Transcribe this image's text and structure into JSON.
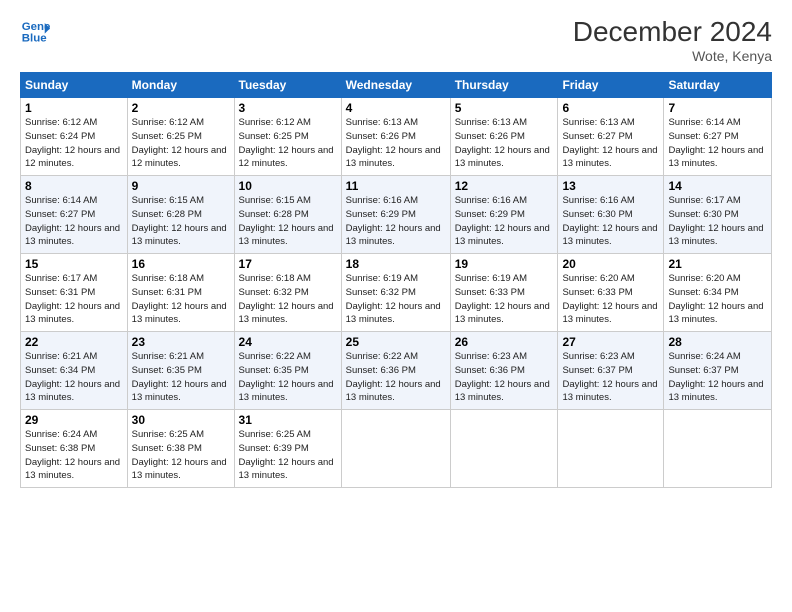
{
  "header": {
    "logo_line1": "General",
    "logo_line2": "Blue",
    "month_title": "December 2024",
    "location": "Wote, Kenya"
  },
  "weekdays": [
    "Sunday",
    "Monday",
    "Tuesday",
    "Wednesday",
    "Thursday",
    "Friday",
    "Saturday"
  ],
  "weeks": [
    [
      {
        "day": "1",
        "sunrise": "6:12 AM",
        "sunset": "6:24 PM",
        "daylight": "12 hours and 12 minutes."
      },
      {
        "day": "2",
        "sunrise": "6:12 AM",
        "sunset": "6:25 PM",
        "daylight": "12 hours and 12 minutes."
      },
      {
        "day": "3",
        "sunrise": "6:12 AM",
        "sunset": "6:25 PM",
        "daylight": "12 hours and 12 minutes."
      },
      {
        "day": "4",
        "sunrise": "6:13 AM",
        "sunset": "6:26 PM",
        "daylight": "12 hours and 13 minutes."
      },
      {
        "day": "5",
        "sunrise": "6:13 AM",
        "sunset": "6:26 PM",
        "daylight": "12 hours and 13 minutes."
      },
      {
        "day": "6",
        "sunrise": "6:13 AM",
        "sunset": "6:27 PM",
        "daylight": "12 hours and 13 minutes."
      },
      {
        "day": "7",
        "sunrise": "6:14 AM",
        "sunset": "6:27 PM",
        "daylight": "12 hours and 13 minutes."
      }
    ],
    [
      {
        "day": "8",
        "sunrise": "6:14 AM",
        "sunset": "6:27 PM",
        "daylight": "12 hours and 13 minutes."
      },
      {
        "day": "9",
        "sunrise": "6:15 AM",
        "sunset": "6:28 PM",
        "daylight": "12 hours and 13 minutes."
      },
      {
        "day": "10",
        "sunrise": "6:15 AM",
        "sunset": "6:28 PM",
        "daylight": "12 hours and 13 minutes."
      },
      {
        "day": "11",
        "sunrise": "6:16 AM",
        "sunset": "6:29 PM",
        "daylight": "12 hours and 13 minutes."
      },
      {
        "day": "12",
        "sunrise": "6:16 AM",
        "sunset": "6:29 PM",
        "daylight": "12 hours and 13 minutes."
      },
      {
        "day": "13",
        "sunrise": "6:16 AM",
        "sunset": "6:30 PM",
        "daylight": "12 hours and 13 minutes."
      },
      {
        "day": "14",
        "sunrise": "6:17 AM",
        "sunset": "6:30 PM",
        "daylight": "12 hours and 13 minutes."
      }
    ],
    [
      {
        "day": "15",
        "sunrise": "6:17 AM",
        "sunset": "6:31 PM",
        "daylight": "12 hours and 13 minutes."
      },
      {
        "day": "16",
        "sunrise": "6:18 AM",
        "sunset": "6:31 PM",
        "daylight": "12 hours and 13 minutes."
      },
      {
        "day": "17",
        "sunrise": "6:18 AM",
        "sunset": "6:32 PM",
        "daylight": "12 hours and 13 minutes."
      },
      {
        "day": "18",
        "sunrise": "6:19 AM",
        "sunset": "6:32 PM",
        "daylight": "12 hours and 13 minutes."
      },
      {
        "day": "19",
        "sunrise": "6:19 AM",
        "sunset": "6:33 PM",
        "daylight": "12 hours and 13 minutes."
      },
      {
        "day": "20",
        "sunrise": "6:20 AM",
        "sunset": "6:33 PM",
        "daylight": "12 hours and 13 minutes."
      },
      {
        "day": "21",
        "sunrise": "6:20 AM",
        "sunset": "6:34 PM",
        "daylight": "12 hours and 13 minutes."
      }
    ],
    [
      {
        "day": "22",
        "sunrise": "6:21 AM",
        "sunset": "6:34 PM",
        "daylight": "12 hours and 13 minutes."
      },
      {
        "day": "23",
        "sunrise": "6:21 AM",
        "sunset": "6:35 PM",
        "daylight": "12 hours and 13 minutes."
      },
      {
        "day": "24",
        "sunrise": "6:22 AM",
        "sunset": "6:35 PM",
        "daylight": "12 hours and 13 minutes."
      },
      {
        "day": "25",
        "sunrise": "6:22 AM",
        "sunset": "6:36 PM",
        "daylight": "12 hours and 13 minutes."
      },
      {
        "day": "26",
        "sunrise": "6:23 AM",
        "sunset": "6:36 PM",
        "daylight": "12 hours and 13 minutes."
      },
      {
        "day": "27",
        "sunrise": "6:23 AM",
        "sunset": "6:37 PM",
        "daylight": "12 hours and 13 minutes."
      },
      {
        "day": "28",
        "sunrise": "6:24 AM",
        "sunset": "6:37 PM",
        "daylight": "12 hours and 13 minutes."
      }
    ],
    [
      {
        "day": "29",
        "sunrise": "6:24 AM",
        "sunset": "6:38 PM",
        "daylight": "12 hours and 13 minutes."
      },
      {
        "day": "30",
        "sunrise": "6:25 AM",
        "sunset": "6:38 PM",
        "daylight": "12 hours and 13 minutes."
      },
      {
        "day": "31",
        "sunrise": "6:25 AM",
        "sunset": "6:39 PM",
        "daylight": "12 hours and 13 minutes."
      },
      null,
      null,
      null,
      null
    ]
  ]
}
